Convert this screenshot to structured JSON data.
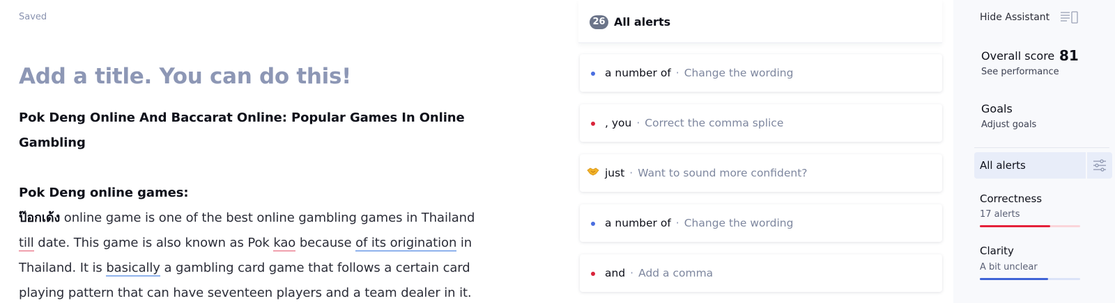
{
  "editor": {
    "status": "Saved",
    "title_placeholder": "Add a title. You can do this!",
    "heading1_line1": "Pok Deng Online And Baccarat Online: Popular Games In Online",
    "heading1_line2": "Gambling",
    "heading2": "Pok Deng online games:",
    "para": {
      "thai": "ป๊อกเด้ง",
      "l1_rest": " online game is one of the best online gambling games in Thailand",
      "l2_w1": "till",
      "l2_t1": " date. This game is also known as Pok ",
      "l2_w2": "kao",
      "l2_t2": " because ",
      "l2_w3": "of its origination",
      "l2_t3": " in",
      "l3_t1": "Thailand. It is ",
      "l3_w1": "basically",
      "l3_t2": " a gambling card game that follows a certain card",
      "l4": "playing pattern that can have seventeen players and a team dealer in it."
    }
  },
  "alerts": {
    "count": "26",
    "title": "All alerts",
    "items": [
      {
        "term": "a number of",
        "hint": "Change the wording",
        "color": "#4a6ee0"
      },
      {
        "term": ", you",
        "hint": "Correct the comma splice",
        "color": "#d9243a"
      },
      {
        "term": "just",
        "hint": "Want to sound more confident?",
        "icon": "handshake-icon"
      },
      {
        "term": "a number of",
        "hint": "Change the wording",
        "color": "#4a6ee0"
      },
      {
        "term": "and",
        "hint": "Add a comma",
        "color": "#d9243a"
      }
    ],
    "separator": "·"
  },
  "sidebar": {
    "hide_label": "Hide Assistant",
    "overall_label": "Overall score",
    "overall_value": "81",
    "overall_sub": "See performance",
    "goals_label": "Goals",
    "goals_sub": "Adjust goals",
    "all_alerts_label": "All alerts",
    "categories": [
      {
        "label": "Correctness",
        "sub": "17 alerts",
        "color": "#e5213a",
        "track": "#fbd5da",
        "progress": 0.7
      },
      {
        "label": "Clarity",
        "sub": "A bit unclear",
        "color": "#3f63d6",
        "track": "#dbe3f8",
        "progress": 0.68
      }
    ]
  }
}
